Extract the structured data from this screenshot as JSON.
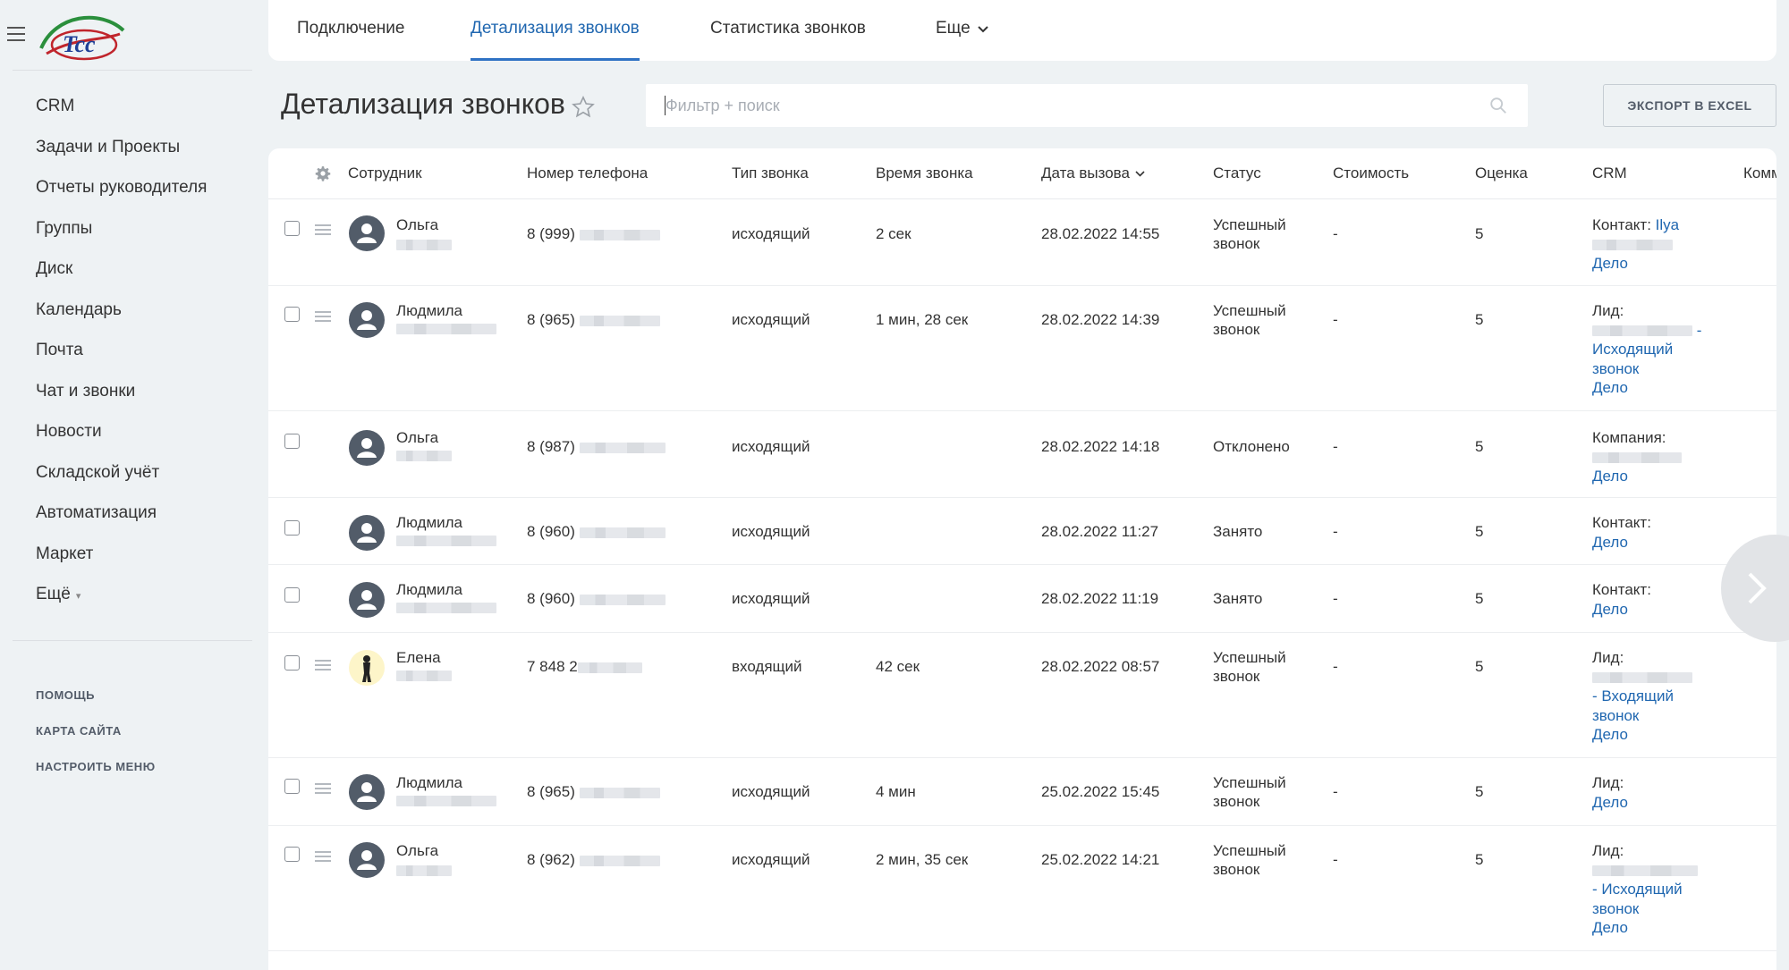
{
  "sidebar": {
    "nav": [
      "CRM",
      "Задачи и Проекты",
      "Отчеты руководителя",
      "Группы",
      "Диск",
      "Календарь",
      "Почта",
      "Чат и звонки",
      "Новости",
      "Складской учёт",
      "Автоматизация",
      "Маркет"
    ],
    "more_label": "Ещё",
    "links": [
      "ПОМОЩЬ",
      "КАРТА САЙТА",
      "НАСТРОИТЬ МЕНЮ"
    ]
  },
  "tabs": {
    "connect": "Подключение",
    "details": "Детализация звонков",
    "stats": "Статистика звонков",
    "more": "Еще"
  },
  "page": {
    "title": "Детализация звонков",
    "search_placeholder": "Фильтр + поиск",
    "export_label": "ЭКСПОРТ В EXCEL"
  },
  "table": {
    "headers": {
      "employee": "Сотрудник",
      "phone": "Номер телефона",
      "type": "Тип звонка",
      "duration": "Время звонка",
      "date": "Дата вызова",
      "status": "Статус",
      "cost": "Стоимость",
      "rating": "Оценка",
      "crm": "CRM",
      "comment": "Комм"
    },
    "rows": [
      {
        "name": "Ольга",
        "name2": "Ш",
        "phone": "8 (999)",
        "type": "исходящий",
        "duration": "2 сек",
        "date": "28.02.2022 14:55",
        "status1": "Успешный",
        "status2": "звонок",
        "cost": "-",
        "rating": "5",
        "crm_label": "Контакт:",
        "crm_link": "Ilya",
        "crm_link2": "",
        "crm_link3": "",
        "crm_deal": "Дело"
      },
      {
        "name": "Людмила",
        "name2": "",
        "phone": "8 (965)",
        "type": "исходящий",
        "duration": "1 мин, 28 сек",
        "date": "28.02.2022 14:39",
        "status1": "Успешный",
        "status2": "звонок",
        "cost": "-",
        "rating": "5",
        "crm_label": "Лид:",
        "crm_link": "-",
        "crm_link2": "Исходящий",
        "crm_link3": "звонок",
        "crm_deal": "Дело"
      },
      {
        "name": "Ольга",
        "name2": "",
        "phone": "8 (987)",
        "type": "исходящий",
        "duration": "",
        "date": "28.02.2022 14:18",
        "status1": "Отклонено",
        "status2": "",
        "cost": "-",
        "rating": "5",
        "crm_label": "Компания:",
        "crm_link": "",
        "crm_link2": "",
        "crm_link3": "",
        "crm_deal": "Дело"
      },
      {
        "name": "Людмила",
        "name2": "",
        "phone": "8 (960)",
        "type": "исходящий",
        "duration": "",
        "date": "28.02.2022 11:27",
        "status1": "Занято",
        "status2": "",
        "cost": "-",
        "rating": "5",
        "crm_label": "Контакт:",
        "crm_link": "",
        "crm_link2": "",
        "crm_link3": "",
        "crm_deal": "Дело"
      },
      {
        "name": "Людмила",
        "name2": "",
        "phone": "8 (960)",
        "type": "исходящий",
        "duration": "",
        "date": "28.02.2022 11:19",
        "status1": "Занято",
        "status2": "",
        "cost": "-",
        "rating": "5",
        "crm_label": "Контакт:",
        "crm_link": "",
        "crm_link2": "",
        "crm_link3": "",
        "crm_deal": "Дело"
      },
      {
        "name": "Елена",
        "name2": "",
        "phone": "7 848 2",
        "type": "входящий",
        "duration": "42 сек",
        "date": "28.02.2022 08:57",
        "status1": "Успешный",
        "status2": "звонок",
        "cost": "-",
        "rating": "5",
        "crm_label": "Лид:",
        "crm_link": "",
        "crm_link2": "- Входящий",
        "crm_link3": "звонок",
        "crm_deal": "Дело"
      },
      {
        "name": "Людмила",
        "name2": "",
        "phone": "8 (965)",
        "type": "исходящий",
        "duration": "4 мин",
        "date": "25.02.2022 15:45",
        "status1": "Успешный",
        "status2": "звонок",
        "cost": "-",
        "rating": "5",
        "crm_label": "Лид:",
        "crm_link": "",
        "crm_link2": "",
        "crm_link3": "",
        "crm_deal": "Дело"
      },
      {
        "name": "Ольга",
        "name2": "Ш",
        "phone": "8 (962)",
        "type": "исходящий",
        "duration": "2 мин, 35 сек",
        "date": "25.02.2022 14:21",
        "status1": "Успешный",
        "status2": "звонок",
        "cost": "-",
        "rating": "5",
        "crm_label": "Лид:",
        "crm_link": "",
        "crm_link2": "- Исходящий",
        "crm_link3": "звонок",
        "crm_deal": "Дело"
      }
    ]
  },
  "colors": {
    "accent": "#2067b0",
    "avatar": "#525c69"
  }
}
